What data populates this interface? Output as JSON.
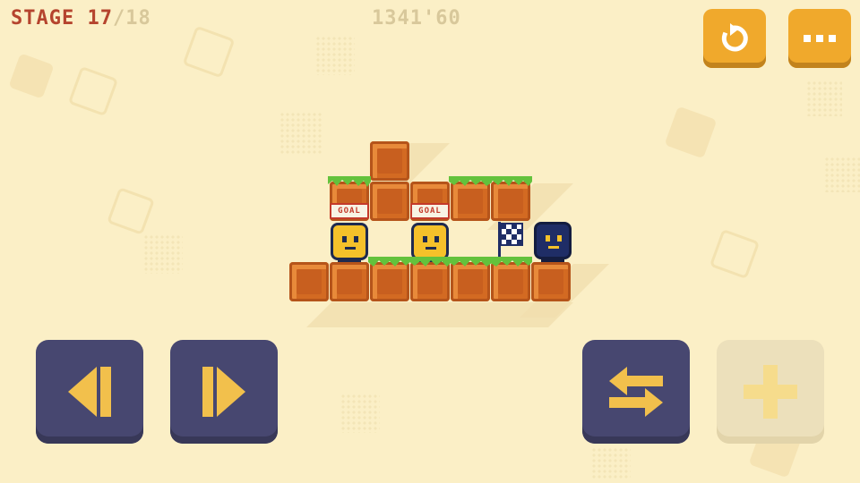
{
  "hud": {
    "stage_label": "STAGE 17",
    "stage_total": "/18",
    "timer": "1341'60",
    "restart_icon": "restart-icon",
    "menu_icon": "more-dots-icon"
  },
  "level": {
    "goal_label": "GOAL",
    "characters": [
      "yellow-block-character",
      "yellow-block-character",
      "navy-block-character"
    ],
    "flag_icon": "checkered-flag-icon"
  },
  "controls": {
    "left_icon": "arrow-left-icon",
    "right_icon": "arrow-right-icon",
    "swap_icon": "swap-arrows-icon",
    "add_icon": "plus-icon",
    "add_enabled": false
  },
  "colors": {
    "background": "#fbefc6",
    "accent_orange": "#f0a92c",
    "block": "#d36a22",
    "control": "#474770",
    "stage_text": "#b5442e",
    "character_yellow": "#f5c12a",
    "character_navy": "#1f2d66"
  }
}
